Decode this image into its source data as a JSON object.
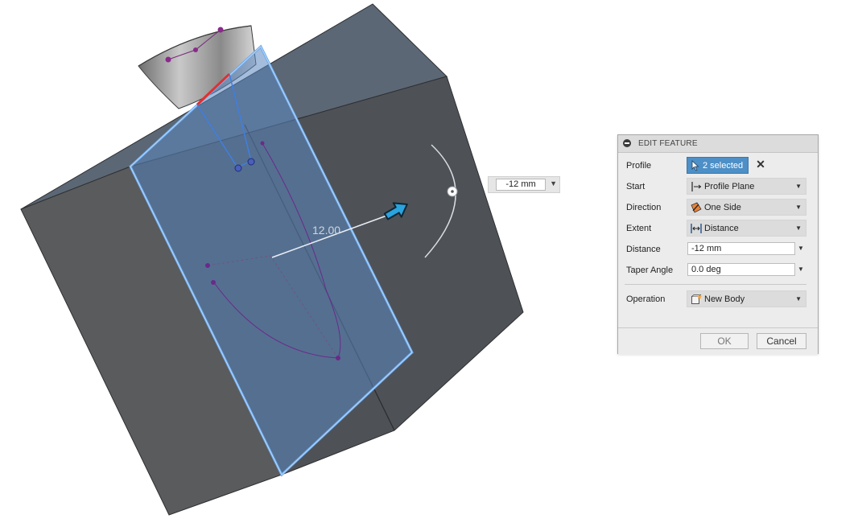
{
  "viewport": {
    "dimension_label": "12.00",
    "float_input_value": "-12 mm"
  },
  "panel": {
    "title": "EDIT FEATURE",
    "rows": {
      "profile": {
        "label": "Profile",
        "value": "2 selected"
      },
      "start": {
        "label": "Start",
        "value": "Profile Plane",
        "icon": "profile-plane-icon"
      },
      "direction": {
        "label": "Direction",
        "value": "One Side",
        "icon": "one-side-icon"
      },
      "extent": {
        "label": "Extent",
        "value": "Distance",
        "icon": "distance-icon"
      },
      "distance": {
        "label": "Distance",
        "value": "-12 mm"
      },
      "taper": {
        "label": "Taper Angle",
        "value": "0.0 deg"
      },
      "operation": {
        "label": "Operation",
        "value": "New Body",
        "icon": "new-body-icon"
      }
    },
    "buttons": {
      "ok": "OK",
      "cancel": "Cancel"
    }
  },
  "colors": {
    "selection_blue": "#4d8fc7",
    "profile_fill": "#5b86bf",
    "body_gray": "#5d6166",
    "arrow_blue": "#2aa3de"
  }
}
